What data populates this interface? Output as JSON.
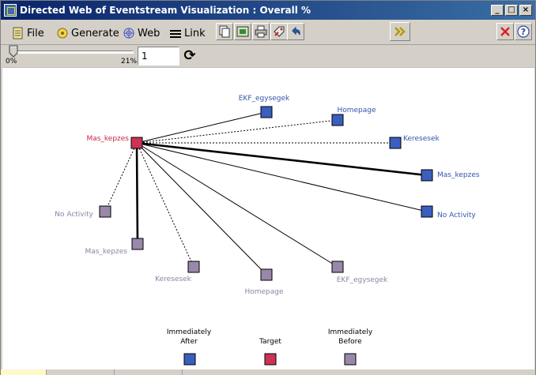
{
  "window": {
    "title": "Directed Web of Eventstream Visualization : Overall %",
    "controls": {
      "minimize": "_",
      "maximize": "□",
      "close": "×"
    }
  },
  "menu": {
    "file": "File",
    "generate": "Generate",
    "web": "Web",
    "link": "Link"
  },
  "toolbar": {
    "icons": [
      "copy-icon",
      "export-icon",
      "print-icon",
      "tag-icon",
      "undo-icon"
    ],
    "forward_icon": "double-chevron-right-icon",
    "close_icon": "red-x-icon",
    "help_icon": "help-icon"
  },
  "slider": {
    "min_label": "0%",
    "max_label": "21%",
    "value": 0,
    "input_value": "1"
  },
  "web": {
    "colors": {
      "after": "#3a5fbf",
      "target": "#cc3355",
      "before": "#9988aa",
      "after_text": "#3355aa",
      "target_text": "#cc2244",
      "before_text": "#9080a8"
    },
    "target_label": "Mas_kepzes",
    "after_labels": [
      "EKF_egysegek",
      "Homepage",
      "Keresesek",
      "Mas_kepzes",
      "No Activity"
    ],
    "before_labels": [
      "No Activity",
      "Mas_kepzes",
      "Keresesek",
      "Homepage",
      "EKF_egysegek"
    ],
    "links": [
      {
        "from": "Mas_kepzes",
        "to": "EKF_egysegek",
        "group": "after",
        "style": "solid",
        "weight": 1
      },
      {
        "from": "Mas_kepzes",
        "to": "Homepage",
        "group": "after",
        "style": "dotted",
        "weight": 1
      },
      {
        "from": "Mas_kepzes",
        "to": "Keresesek",
        "group": "after",
        "style": "dotted",
        "weight": 1
      },
      {
        "from": "Mas_kepzes",
        "to": "Mas_kepzes",
        "group": "after",
        "style": "solid",
        "weight": 3
      },
      {
        "from": "Mas_kepzes",
        "to": "No Activity",
        "group": "after",
        "style": "solid",
        "weight": 1
      },
      {
        "from": "No Activity",
        "to": "Mas_kepzes",
        "group": "before",
        "style": "dotted",
        "weight": 1
      },
      {
        "from": "Mas_kepzes",
        "to": "Mas_kepzes",
        "group": "before",
        "style": "solid",
        "weight": 3
      },
      {
        "from": "Keresesek",
        "to": "Mas_kepzes",
        "group": "before",
        "style": "dotted",
        "weight": 1
      },
      {
        "from": "Homepage",
        "to": "Mas_kepzes",
        "group": "before",
        "style": "solid",
        "weight": 1
      },
      {
        "from": "EKF_egysegek",
        "to": "Mas_kepzes",
        "group": "before",
        "style": "solid",
        "weight": 1
      }
    ]
  },
  "legend": {
    "after_line1": "Immediately",
    "after_line2": "After",
    "target": "Target",
    "before_line1": "Immediately",
    "before_line2": "Before"
  }
}
